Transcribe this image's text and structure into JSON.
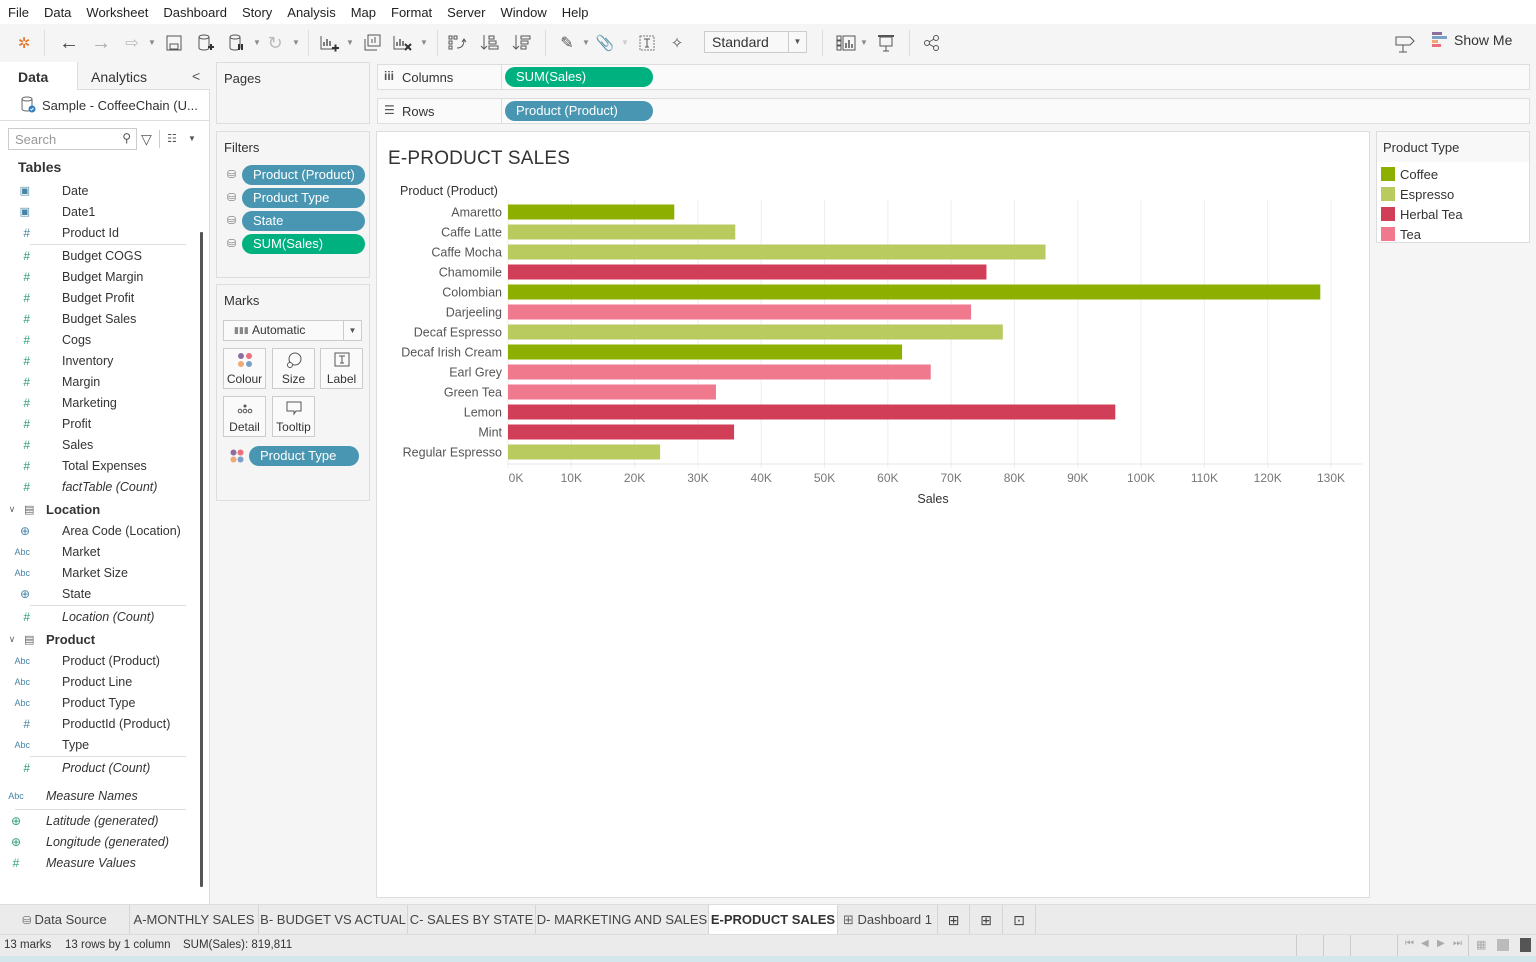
{
  "menu": [
    "File",
    "Data",
    "Worksheet",
    "Dashboard",
    "Story",
    "Analysis",
    "Map",
    "Format",
    "Server",
    "Window",
    "Help"
  ],
  "toolbar": {
    "fit_select": "Standard",
    "show_me_label": "Show Me",
    "icons": [
      "tableau-logo-icon",
      "undo-icon",
      "redo-icon",
      "replay-icon",
      "save-icon",
      "new-datasource-icon",
      "pause-updates-icon",
      "refresh-icon",
      "new-worksheet-icon",
      "duplicate-sheet-icon",
      "clear-sheet-icon",
      "swap-icon",
      "sort-ascending-icon",
      "sort-descending-icon",
      "highlight-icon",
      "group-icon",
      "label-icon",
      "pin-icon",
      "show-cards-icon",
      "presentation-icon",
      "share-icon",
      "tooltip-icon"
    ]
  },
  "left_panel": {
    "tab_data": "Data",
    "tab_analytics": "Analytics",
    "datasource": "Sample - CoffeeChain (U...",
    "search_placeholder": "Search",
    "tables_label": "Tables",
    "fact_fields": [
      {
        "name": "Date",
        "type": "date"
      },
      {
        "name": "Date1",
        "type": "date"
      },
      {
        "name": "Product Id",
        "type": "number"
      }
    ],
    "measures": [
      "Budget COGS",
      "Budget Margin",
      "Budget Profit",
      "Budget Sales",
      "Cogs",
      "Inventory",
      "Margin",
      "Marketing",
      "Profit",
      "Sales",
      "Total Expenses"
    ],
    "fact_count": "factTable (Count)",
    "location": {
      "label": "Location",
      "fields": [
        {
          "name": "Area Code (Location)",
          "type": "geo"
        },
        {
          "name": "Market",
          "type": "string"
        },
        {
          "name": "Market Size",
          "type": "string"
        },
        {
          "name": "State",
          "type": "geo"
        }
      ],
      "count": "Location (Count)"
    },
    "product": {
      "label": "Product",
      "fields": [
        {
          "name": "Product (Product)",
          "type": "string"
        },
        {
          "name": "Product Line",
          "type": "string"
        },
        {
          "name": "Product Type",
          "type": "string"
        },
        {
          "name": "ProductId (Product)",
          "type": "number"
        },
        {
          "name": "Type",
          "type": "string"
        }
      ],
      "count": "Product (Count)"
    },
    "measure_names": "Measure Names",
    "generated": [
      "Latitude (generated)",
      "Longitude (generated)"
    ],
    "measure_values": "Measure Values"
  },
  "cards": {
    "pages_title": "Pages",
    "filters_title": "Filters",
    "filters": [
      {
        "label": "Product (Product)",
        "kind": "dimension"
      },
      {
        "label": "Product Type",
        "kind": "dimension"
      },
      {
        "label": "State",
        "kind": "dimension"
      },
      {
        "label": "SUM(Sales)",
        "kind": "measure"
      }
    ],
    "marks_title": "Marks",
    "mark_type": "Automatic",
    "mark_buttons": [
      "Colour",
      "Size",
      "Label",
      "Detail",
      "Tooltip"
    ],
    "color_pill": "Product Type"
  },
  "shelves": {
    "columns_label": "Columns",
    "columns_pill": "SUM(Sales)",
    "rows_label": "Rows",
    "rows_pill": "Product (Product)"
  },
  "sheet_title": "E-PRODUCT SALES",
  "legend": {
    "title": "Product Type",
    "items": [
      {
        "label": "Coffee",
        "color": "#8db000"
      },
      {
        "label": "Espresso",
        "color": "#b9cb5e"
      },
      {
        "label": "Herbal Tea",
        "color": "#d03e57"
      },
      {
        "label": "Tea",
        "color": "#f1798d"
      }
    ]
  },
  "chart_data": {
    "type": "bar",
    "orientation": "horizontal",
    "title": "E-PRODUCT SALES",
    "row_header": "Product (Product)",
    "xlabel": "Sales",
    "ylabel": "Product (Product)",
    "xlim": [
      0,
      135000
    ],
    "x_ticks": [
      "0K",
      "10K",
      "20K",
      "30K",
      "40K",
      "50K",
      "60K",
      "70K",
      "80K",
      "90K",
      "100K",
      "110K",
      "120K",
      "130K"
    ],
    "x_tick_values": [
      0,
      10000,
      20000,
      30000,
      40000,
      50000,
      60000,
      70000,
      80000,
      90000,
      100000,
      110000,
      120000,
      130000
    ],
    "grid": true,
    "legend_position": "right",
    "categories": [
      "Amaretto",
      "Caffe Latte",
      "Caffe Mocha",
      "Chamomile",
      "Colombian",
      "Darjeeling",
      "Decaf Espresso",
      "Decaf Irish Cream",
      "Earl Grey",
      "Green Tea",
      "Lemon",
      "Mint",
      "Regular Espresso"
    ],
    "values": [
      26269,
      35899,
      84904,
      75578,
      128311,
      73151,
      78162,
      62248,
      66772,
      32850,
      95926,
      35710,
      24031
    ],
    "color_group": [
      "Coffee",
      "Espresso",
      "Espresso",
      "Herbal Tea",
      "Coffee",
      "Tea",
      "Espresso",
      "Coffee",
      "Tea",
      "Tea",
      "Herbal Tea",
      "Herbal Tea",
      "Espresso"
    ]
  },
  "sheet_tabs": {
    "data_source": "Data Source",
    "tabs": [
      "A-MONTHLY SALES",
      "B- BUDGET VS ACTUAL",
      "C- SALES BY STATE",
      "D- MARKETING AND SALES",
      "E-PRODUCT SALES",
      "Dashboard 1"
    ],
    "active": "E-PRODUCT SALES"
  },
  "status": {
    "marks": "13 marks",
    "rows_cols": "13 rows by 1 column",
    "sum": "SUM(Sales): 819,811"
  }
}
